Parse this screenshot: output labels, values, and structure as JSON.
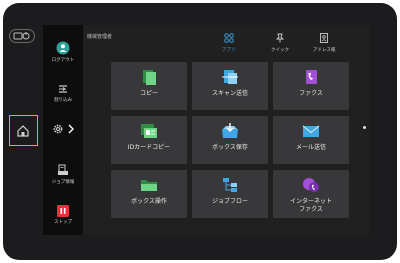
{
  "header": {
    "title": "機械管理者"
  },
  "tabs": [
    {
      "label": "アプリ",
      "icon": "apps-grid-icon",
      "active": true
    },
    {
      "label": "クイック",
      "icon": "quick-pin-icon",
      "active": false
    },
    {
      "label": "アドレス帳",
      "icon": "address-book-icon",
      "active": false
    }
  ],
  "sidebar": {
    "logout": {
      "label": "ログアウト",
      "icon": "user-logout-icon"
    },
    "interrupt": {
      "label": "割り込み",
      "icon": "interrupt-icon"
    },
    "settings": {
      "icon": "gear-icon",
      "expand_icon": "chevron-right-icon"
    },
    "job_status": {
      "label": "ジョブ情報",
      "icon": "job-status-icon"
    },
    "stop": {
      "label": "ストップ",
      "icon": "stop-icon"
    }
  },
  "apps": [
    {
      "label": "コピー",
      "icon": "copy-icon"
    },
    {
      "label": "スキャン送信",
      "icon": "scan-send-icon"
    },
    {
      "label": "ファクス",
      "icon": "fax-icon"
    },
    {
      "label": "IDカードコピー",
      "icon": "id-card-copy-icon"
    },
    {
      "label": "ボックス保存",
      "icon": "box-save-icon"
    },
    {
      "label": "メール送信",
      "icon": "email-send-icon"
    },
    {
      "label": "ボックス操作",
      "icon": "box-operation-icon"
    },
    {
      "label": "ジョブフロー",
      "icon": "job-flow-icon"
    },
    {
      "label": "インターネット\nファクス",
      "icon": "internet-fax-icon"
    }
  ],
  "colors": {
    "home_highlight": "#e8a33a",
    "accent_blue": "#3fa7e6",
    "stop_red": "#e8323c",
    "copy_green": "#42b85a",
    "fax_purple": "#a24fd8"
  }
}
